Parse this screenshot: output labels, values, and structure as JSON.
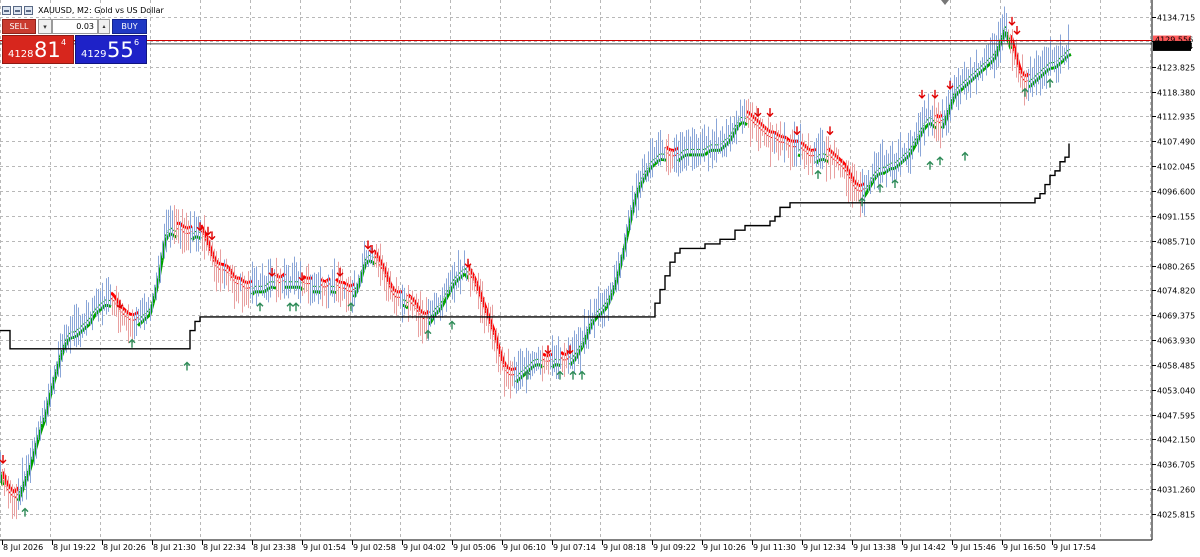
{
  "header": {
    "title": "XAUUSD, M2:  Gold vs US Dollar"
  },
  "trade_panel": {
    "sell_label": "SELL",
    "buy_label": "BUY",
    "lot_value": "0.03",
    "sell_price_small": "4128",
    "sell_price_big": "81",
    "sell_price_sup": "4",
    "buy_price_small": "4129",
    "buy_price_big": "55",
    "buy_price_sup": "6"
  },
  "colors": {
    "bid_line": "#cc0000",
    "ask_line": "#ff9d9d",
    "bid_label_bg": "#000000",
    "trend_up": "#00a000",
    "trend_down": "#ff0000",
    "step_line": "#000000",
    "up_arrow": "#2e8b57",
    "down_arrow": "#e00000",
    "grid": "#b8b8b8"
  },
  "chart_data": {
    "type": "line",
    "symbol": "XAUUSD",
    "timeframe": "M2",
    "price_ticks": [
      4134.715,
      4129.5,
      4123.825,
      4118.38,
      4112.935,
      4107.49,
      4102.045,
      4096.6,
      4091.155,
      4085.71,
      4080.265,
      4074.82,
      4069.375,
      4063.93,
      4058.485,
      4053.04,
      4047.595,
      4042.15,
      4036.705,
      4031.26,
      4025.815
    ],
    "price_tick_labels": [
      "4134.715",
      "",
      "4123.825",
      "4118.380",
      "4112.935",
      "4107.490",
      "4102.045",
      "4096.600",
      "4091.155",
      "4085.710",
      "4080.265",
      "4074.820",
      "4069.375",
      "4063.930",
      "4058.485",
      "4053.040",
      "4047.595",
      "4042.150",
      "4036.705",
      "4031.260",
      "4025.815"
    ],
    "time_labels": [
      "8 Jul 2026",
      "8 Jul 19:22",
      "8 Jul 20:26",
      "8 Jul 21:30",
      "8 Jul 22:34",
      "8 Jul 23:38",
      "9 Jul 01:54",
      "9 Jul 02:58",
      "9 Jul 04:02",
      "9 Jul 05:06",
      "9 Jul 06:10",
      "9 Jul 07:14",
      "9 Jul 08:18",
      "9 Jul 09:22",
      "9 Jul 10:26",
      "9 Jul 11:30",
      "9 Jul 12:34",
      "9 Jul 13:38",
      "9 Jul 14:42",
      "9 Jul 15:46",
      "9 Jul 16:50",
      "9 Jul 17:54"
    ],
    "y_range": [
      4022.5,
      4137.0
    ],
    "bid_price": 4128.814,
    "ask_price": 4129.556,
    "bid_label": "4128.814",
    "ask_label": "4129.556",
    "price_series": [
      [
        0,
        4036
      ],
      [
        5,
        4032
      ],
      [
        10,
        4030
      ],
      [
        15,
        4029
      ],
      [
        20,
        4031
      ],
      [
        25,
        4034
      ],
      [
        30,
        4037
      ],
      [
        35,
        4041
      ],
      [
        40,
        4045
      ],
      [
        45,
        4048
      ],
      [
        50,
        4053
      ],
      [
        55,
        4057
      ],
      [
        60,
        4061
      ],
      [
        65,
        4064
      ],
      [
        70,
        4066
      ],
      [
        75,
        4066
      ],
      [
        80,
        4067
      ],
      [
        85,
        4068
      ],
      [
        90,
        4069
      ],
      [
        95,
        4071
      ],
      [
        100,
        4072
      ],
      [
        105,
        4073
      ],
      [
        110,
        4073
      ],
      [
        115,
        4072
      ],
      [
        120,
        4070
      ],
      [
        125,
        4069
      ],
      [
        130,
        4068
      ],
      [
        135,
        4068
      ],
      [
        140,
        4069
      ],
      [
        145,
        4070
      ],
      [
        150,
        4071
      ],
      [
        155,
        4075
      ],
      [
        160,
        4080
      ],
      [
        165,
        4087
      ],
      [
        170,
        4089
      ],
      [
        175,
        4088
      ],
      [
        180,
        4088
      ],
      [
        185,
        4087
      ],
      [
        190,
        4087
      ],
      [
        195,
        4088
      ],
      [
        200,
        4088
      ],
      [
        205,
        4086
      ],
      [
        210,
        4083
      ],
      [
        215,
        4080
      ],
      [
        220,
        4079
      ],
      [
        225,
        4079
      ],
      [
        230,
        4078
      ],
      [
        235,
        4076
      ],
      [
        240,
        4076
      ],
      [
        245,
        4075
      ],
      [
        250,
        4075
      ],
      [
        255,
        4076
      ],
      [
        260,
        4076
      ],
      [
        265,
        4076
      ],
      [
        270,
        4077
      ],
      [
        275,
        4077
      ],
      [
        280,
        4076
      ],
      [
        285,
        4077
      ],
      [
        290,
        4077
      ],
      [
        295,
        4077
      ],
      [
        300,
        4077
      ],
      [
        305,
        4076
      ],
      [
        310,
        4076
      ],
      [
        315,
        4076
      ],
      [
        320,
        4076
      ],
      [
        325,
        4075
      ],
      [
        330,
        4076
      ],
      [
        335,
        4076
      ],
      [
        340,
        4075
      ],
      [
        345,
        4075
      ],
      [
        350,
        4074
      ],
      [
        355,
        4075
      ],
      [
        360,
        4078
      ],
      [
        365,
        4082
      ],
      [
        370,
        4083
      ],
      [
        375,
        4082
      ],
      [
        380,
        4080
      ],
      [
        385,
        4078
      ],
      [
        390,
        4075
      ],
      [
        395,
        4073
      ],
      [
        400,
        4073
      ],
      [
        405,
        4073
      ],
      [
        410,
        4072
      ],
      [
        415,
        4071
      ],
      [
        420,
        4069
      ],
      [
        425,
        4068
      ],
      [
        430,
        4069
      ],
      [
        435,
        4071
      ],
      [
        440,
        4072
      ],
      [
        445,
        4074
      ],
      [
        450,
        4076
      ],
      [
        455,
        4078
      ],
      [
        460,
        4079
      ],
      [
        465,
        4080
      ],
      [
        470,
        4078
      ],
      [
        475,
        4076
      ],
      [
        480,
        4073
      ],
      [
        485,
        4070
      ],
      [
        490,
        4067
      ],
      [
        495,
        4064
      ],
      [
        500,
        4060
      ],
      [
        505,
        4057
      ],
      [
        510,
        4056
      ],
      [
        515,
        4056
      ],
      [
        520,
        4057
      ],
      [
        525,
        4058
      ],
      [
        530,
        4059
      ],
      [
        535,
        4060
      ],
      [
        540,
        4060
      ],
      [
        545,
        4059
      ],
      [
        550,
        4059
      ],
      [
        555,
        4060
      ],
      [
        560,
        4060
      ],
      [
        565,
        4059
      ],
      [
        570,
        4060
      ],
      [
        575,
        4061
      ],
      [
        580,
        4063
      ],
      [
        585,
        4065
      ],
      [
        590,
        4068
      ],
      [
        595,
        4070
      ],
      [
        600,
        4071
      ],
      [
        605,
        4072
      ],
      [
        610,
        4074
      ],
      [
        615,
        4077
      ],
      [
        620,
        4081
      ],
      [
        625,
        4086
      ],
      [
        630,
        4091
      ],
      [
        635,
        4096
      ],
      [
        640,
        4099
      ],
      [
        645,
        4101
      ],
      [
        650,
        4103
      ],
      [
        655,
        4104
      ],
      [
        660,
        4105
      ],
      [
        665,
        4105
      ],
      [
        670,
        4104
      ],
      [
        675,
        4104
      ],
      [
        680,
        4105
      ],
      [
        685,
        4106
      ],
      [
        690,
        4106
      ],
      [
        695,
        4106
      ],
      [
        700,
        4106
      ],
      [
        705,
        4106
      ],
      [
        710,
        4107
      ],
      [
        715,
        4107
      ],
      [
        720,
        4107
      ],
      [
        725,
        4108
      ],
      [
        730,
        4109
      ],
      [
        735,
        4111
      ],
      [
        740,
        4113
      ],
      [
        745,
        4113
      ],
      [
        750,
        4112
      ],
      [
        755,
        4111
      ],
      [
        760,
        4110
      ],
      [
        765,
        4109
      ],
      [
        770,
        4108
      ],
      [
        775,
        4108
      ],
      [
        780,
        4107
      ],
      [
        785,
        4107
      ],
      [
        790,
        4106
      ],
      [
        795,
        4106
      ],
      [
        800,
        4106
      ],
      [
        805,
        4105
      ],
      [
        810,
        4104
      ],
      [
        815,
        4104
      ],
      [
        820,
        4105
      ],
      [
        825,
        4105
      ],
      [
        830,
        4104
      ],
      [
        835,
        4103
      ],
      [
        840,
        4102
      ],
      [
        845,
        4101
      ],
      [
        850,
        4099
      ],
      [
        855,
        4097
      ],
      [
        860,
        4096
      ],
      [
        865,
        4097
      ],
      [
        870,
        4099
      ],
      [
        875,
        4101
      ],
      [
        880,
        4102
      ],
      [
        885,
        4102
      ],
      [
        890,
        4103
      ],
      [
        895,
        4103
      ],
      [
        900,
        4104
      ],
      [
        905,
        4105
      ],
      [
        910,
        4106
      ],
      [
        915,
        4108
      ],
      [
        920,
        4110
      ],
      [
        925,
        4112
      ],
      [
        930,
        4113
      ],
      [
        935,
        4112
      ],
      [
        940,
        4111
      ],
      [
        945,
        4113
      ],
      [
        950,
        4116
      ],
      [
        955,
        4119
      ],
      [
        960,
        4120
      ],
      [
        965,
        4121
      ],
      [
        970,
        4122
      ],
      [
        975,
        4123
      ],
      [
        980,
        4124
      ],
      [
        985,
        4125
      ],
      [
        990,
        4126
      ],
      [
        995,
        4127
      ],
      [
        1000,
        4130
      ],
      [
        1005,
        4133
      ],
      [
        1010,
        4130
      ],
      [
        1015,
        4126
      ],
      [
        1020,
        4122
      ],
      [
        1025,
        4120
      ],
      [
        1030,
        4121
      ],
      [
        1035,
        4122
      ],
      [
        1040,
        4123
      ],
      [
        1045,
        4124
      ],
      [
        1050,
        4125
      ],
      [
        1055,
        4125
      ],
      [
        1060,
        4126
      ],
      [
        1065,
        4127
      ],
      [
        1069,
        4128
      ]
    ],
    "step_line": [
      [
        0,
        4066
      ],
      [
        8,
        4066
      ],
      [
        10,
        4062
      ],
      [
        185,
        4062
      ],
      [
        190,
        4066
      ],
      [
        195,
        4068
      ],
      [
        200,
        4069
      ],
      [
        650,
        4069
      ],
      [
        655,
        4072
      ],
      [
        660,
        4075
      ],
      [
        665,
        4078
      ],
      [
        670,
        4081
      ],
      [
        675,
        4083
      ],
      [
        680,
        4084
      ],
      [
        700,
        4084
      ],
      [
        705,
        4085
      ],
      [
        715,
        4085
      ],
      [
        720,
        4086
      ],
      [
        730,
        4086
      ],
      [
        735,
        4088
      ],
      [
        745,
        4089
      ],
      [
        770,
        4090
      ],
      [
        775,
        4091
      ],
      [
        780,
        4093
      ],
      [
        790,
        4094
      ],
      [
        1030,
        4094
      ],
      [
        1035,
        4095
      ],
      [
        1040,
        4096
      ],
      [
        1045,
        4098
      ],
      [
        1050,
        4100
      ],
      [
        1055,
        4101
      ],
      [
        1060,
        4103
      ],
      [
        1065,
        4104
      ],
      [
        1069,
        4107
      ]
    ],
    "down_arrows": [
      [
        3,
        4037
      ],
      [
        120,
        4071
      ],
      [
        200,
        4088
      ],
      [
        208,
        4087
      ],
      [
        212,
        4086
      ],
      [
        272,
        4078
      ],
      [
        302,
        4077
      ],
      [
        340,
        4078
      ],
      [
        368,
        4084
      ],
      [
        372,
        4083
      ],
      [
        468,
        4080
      ],
      [
        548,
        4061
      ],
      [
        570,
        4061
      ],
      [
        758,
        4113
      ],
      [
        770,
        4113
      ],
      [
        797,
        4109
      ],
      [
        830,
        4109
      ],
      [
        922,
        4117
      ],
      [
        935,
        4117
      ],
      [
        950,
        4119
      ],
      [
        1012,
        4133
      ],
      [
        1017,
        4131
      ]
    ],
    "up_arrows": [
      [
        25,
        4027
      ],
      [
        132,
        4064
      ],
      [
        187,
        4059
      ],
      [
        260,
        4072
      ],
      [
        290,
        4072
      ],
      [
        296,
        4072
      ],
      [
        351,
        4072
      ],
      [
        428,
        4066
      ],
      [
        452,
        4068
      ],
      [
        527,
        4057
      ],
      [
        560,
        4057
      ],
      [
        573,
        4057
      ],
      [
        582,
        4057
      ],
      [
        818,
        4101
      ],
      [
        862,
        4095
      ],
      [
        880,
        4098
      ],
      [
        895,
        4099
      ],
      [
        930,
        4103
      ],
      [
        940,
        4104
      ],
      [
        965,
        4105
      ],
      [
        1025,
        4119
      ],
      [
        1050,
        4121
      ]
    ],
    "grid": true
  }
}
